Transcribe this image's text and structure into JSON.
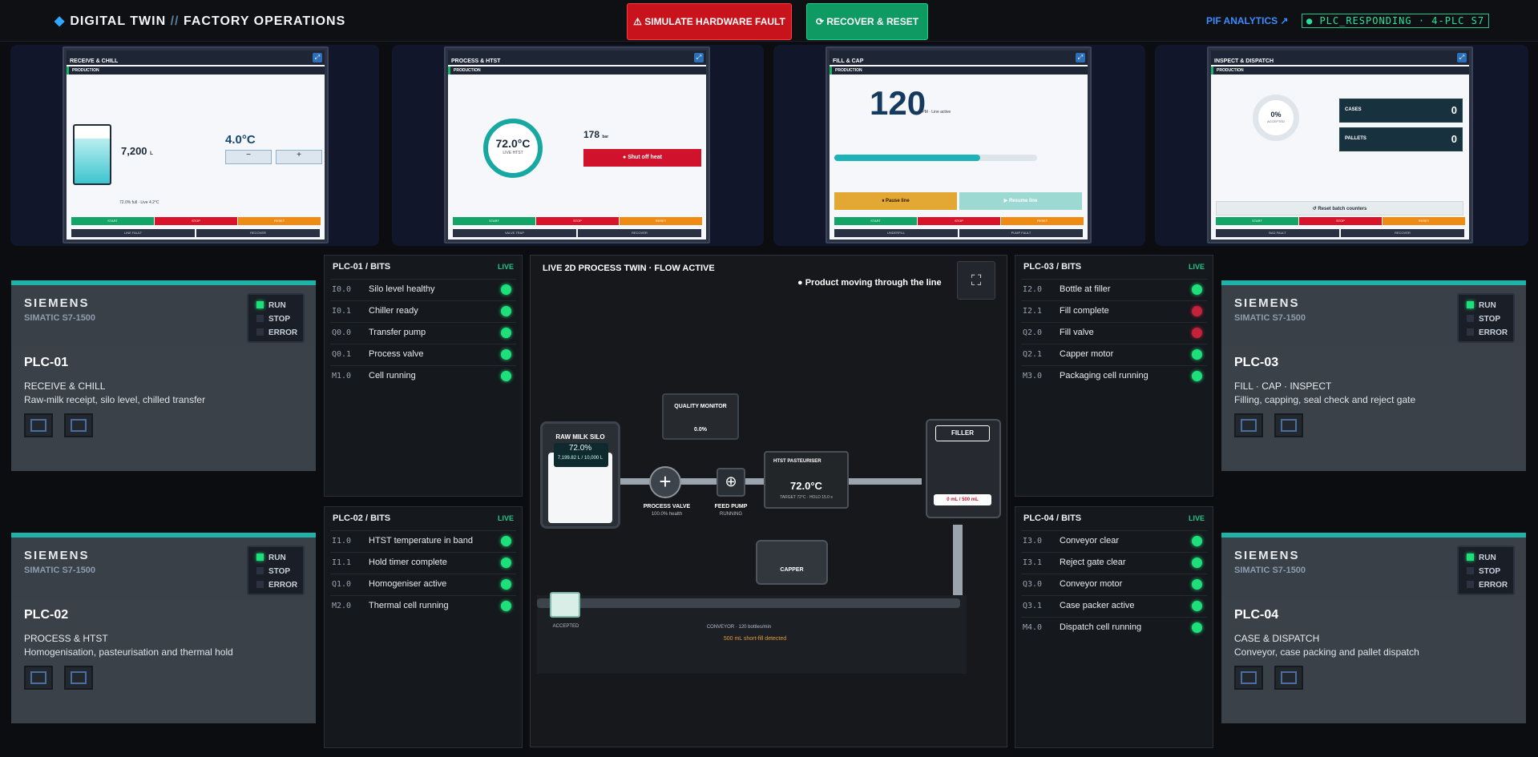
{
  "header": {
    "brand_a": "DIGITAL TWIN",
    "brand_sep": "//",
    "brand_b": "FACTORY OPERATIONS",
    "fault_btn": "⚠ SIMULATE HARDWARE FAULT",
    "reset_btn": "⟳ RECOVER & RESET",
    "pif": "PIF ANALYTICS ↗",
    "status": "● PLC_RESPONDING · 4-PLC S7"
  },
  "hmis": [
    {
      "title": "RECEIVE & CHILL",
      "mode": "PRODUCTION",
      "value": "7,200",
      "unit": "L",
      "temp": "4.0°C",
      "level": "72.0% full · Live 4.2°C"
    },
    {
      "title": "PROCESS & HTST",
      "mode": "PRODUCTION",
      "temp": "72.0°C",
      "sub": "LIVE HTST",
      "pressure": "178",
      "pressure_unit": "bar",
      "shut": "● Shut off heat"
    },
    {
      "title": "FILL & CAP",
      "mode": "PRODUCTION",
      "bpm": "120",
      "bpm_unit": "BPM · Line active",
      "pause": "⏸ Pause line",
      "resume": "▶ Resume line"
    },
    {
      "title": "INSPECT & DISPATCH",
      "mode": "PRODUCTION",
      "accept": "0%",
      "accept_lbl": "ACCEPTED",
      "cases": "0",
      "pallets": "0",
      "cases_lbl": "CASES",
      "pallets_lbl": "PALLETS",
      "reset": "↺ Reset batch counters"
    }
  ],
  "bits": [
    {
      "title": "PLC-01 / BITS",
      "live": "LIVE",
      "rows": [
        [
          "I0.0",
          "Silo level healthy"
        ],
        [
          "I0.1",
          "Chiller ready"
        ],
        [
          "Q0.0",
          "Transfer pump"
        ],
        [
          "Q0.1",
          "Process valve"
        ],
        [
          "M1.0",
          "Cell running"
        ]
      ]
    },
    {
      "title": "PLC-02 / BITS",
      "live": "LIVE",
      "rows": [
        [
          "I1.0",
          "HTST temperature in band"
        ],
        [
          "I1.1",
          "Hold timer complete"
        ],
        [
          "Q1.0",
          "Homogeniser active"
        ],
        [
          "M2.0",
          "Thermal cell running"
        ]
      ]
    },
    {
      "title": "PLC-03 / BITS",
      "live": "LIVE",
      "rows": [
        [
          "I2.0",
          "Bottle at filler"
        ],
        [
          "I2.1",
          "Fill complete"
        ],
        [
          "Q2.0",
          "Fill valve"
        ],
        [
          "Q2.1",
          "Capper motor"
        ],
        [
          "M3.0",
          "Packaging cell running"
        ]
      ]
    },
    {
      "title": "PLC-04 / BITS",
      "live": "LIVE",
      "rows": [
        [
          "I3.0",
          "Conveyor clear"
        ],
        [
          "I3.1",
          "Reject gate clear"
        ],
        [
          "Q3.0",
          "Conveyor motor"
        ],
        [
          "Q3.1",
          "Case packer active"
        ],
        [
          "M4.0",
          "Dispatch cell running"
        ]
      ]
    }
  ],
  "plcs": [
    {
      "brand": "SIEMENS",
      "model": "SIMATIC S7-1500",
      "run": "RUN",
      "stop": "STOP",
      "error": "ERROR",
      "id": "PLC-01",
      "name": "RECEIVE & CHILL",
      "desc": "Raw-milk receipt, silo level, chilled transfer"
    },
    {
      "brand": "SIEMENS",
      "model": "SIMATIC S7-1500",
      "run": "RUN",
      "stop": "STOP",
      "error": "ERROR",
      "id": "PLC-02",
      "name": "PROCESS & HTST",
      "desc": "Homogenisation, pasteurisation and thermal hold"
    },
    {
      "brand": "SIEMENS",
      "model": "SIMATIC S7-1500",
      "run": "RUN",
      "stop": "STOP",
      "error": "ERROR",
      "id": "PLC-03",
      "name": "FILL · CAP · INSPECT",
      "desc": "Filling, capping, seal check and reject gate"
    },
    {
      "brand": "SIEMENS",
      "model": "SIMATIC S7-1500",
      "run": "RUN",
      "stop": "STOP",
      "error": "ERROR",
      "id": "PLC-04",
      "name": "CASE & DISPATCH",
      "desc": "Conveyor, case packing and pallet dispatch"
    }
  ],
  "twin": {
    "title": "LIVE 2D PROCESS TWIN · FLOW ACTIVE",
    "status": "● Product moving through the line",
    "silo": "RAW MILK SILO",
    "silo_pct": "72.0%",
    "silo_vol": "7,199.82 L / 10,000 L",
    "qm": "QUALITY MONITOR",
    "qm_rate": "0.0%",
    "valve": "PROCESS VALVE",
    "valve_h": "100.0% health",
    "pump": "FEED PUMP",
    "pump_s": "RUNNING",
    "htst": "HTST PASTEURISER",
    "htst_t": "72.0°C",
    "htst_sub": "TARGET 72°C · HOLD 15.0 s",
    "filler": "FILLER",
    "fill": "0 mL / 500 mL",
    "capper": "CAPPER",
    "accepted": "ACCEPTED",
    "conveyor": "CONVEYOR · 120 bottles/min",
    "alert": "500 mL short-fill detected"
  }
}
